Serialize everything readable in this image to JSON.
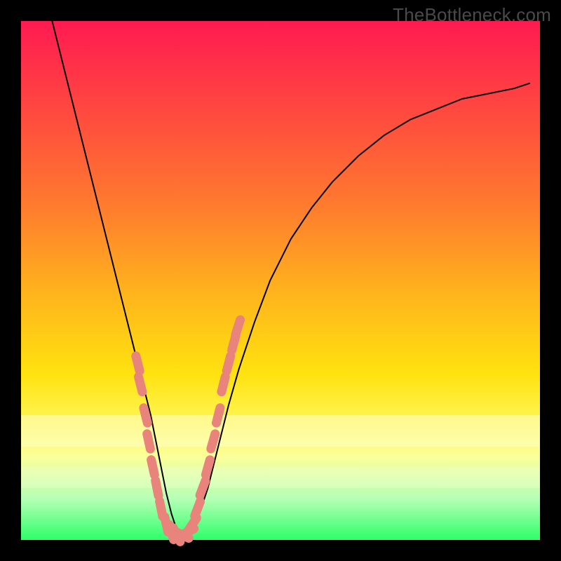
{
  "watermark": "TheBottleneck.com",
  "colors": {
    "page_bg": "#000000",
    "curve_stroke": "#000000",
    "marker_fill": "#e9847d",
    "marker_stroke": "#d96f68",
    "watermark_text": "#4a4a4a"
  },
  "chart_data": {
    "type": "line",
    "title": "",
    "xlabel": "",
    "ylabel": "",
    "xlim": [
      0,
      100
    ],
    "ylim": [
      0,
      100
    ],
    "grid": false,
    "legend": false,
    "series": [
      {
        "name": "bottleneck-curve",
        "x": [
          6,
          8,
          10,
          12,
          14,
          16,
          18,
          20,
          22,
          23,
          24,
          25,
          26,
          27,
          28,
          29,
          30,
          31,
          32,
          33,
          34,
          36,
          38,
          40,
          42,
          45,
          48,
          52,
          56,
          60,
          65,
          70,
          75,
          80,
          85,
          90,
          95,
          98
        ],
        "y": [
          100,
          92,
          84,
          76,
          68,
          60,
          52,
          44,
          36,
          32,
          28,
          24,
          19,
          14,
          9,
          5,
          2,
          1,
          1,
          2,
          4,
          10,
          18,
          26,
          33,
          42,
          50,
          58,
          64,
          69,
          74,
          78,
          81,
          83,
          85,
          86,
          87,
          88
        ]
      }
    ],
    "markers": [
      {
        "x": 22.5,
        "y": 34
      },
      {
        "x": 23.0,
        "y": 30
      },
      {
        "x": 24.0,
        "y": 24
      },
      {
        "x": 24.6,
        "y": 19
      },
      {
        "x": 25.4,
        "y": 14
      },
      {
        "x": 26.2,
        "y": 10
      },
      {
        "x": 27.0,
        "y": 6
      },
      {
        "x": 28.0,
        "y": 3
      },
      {
        "x": 29.0,
        "y": 1.5
      },
      {
        "x": 30.0,
        "y": 1
      },
      {
        "x": 31.0,
        "y": 1
      },
      {
        "x": 32.0,
        "y": 1.5
      },
      {
        "x": 33.0,
        "y": 3
      },
      {
        "x": 34.0,
        "y": 6
      },
      {
        "x": 35.0,
        "y": 10
      },
      {
        "x": 36.0,
        "y": 14
      },
      {
        "x": 37.0,
        "y": 19
      },
      {
        "x": 38.0,
        "y": 24
      },
      {
        "x": 39.0,
        "y": 30
      },
      {
        "x": 40.0,
        "y": 34
      },
      {
        "x": 41.0,
        "y": 38
      },
      {
        "x": 41.8,
        "y": 41
      }
    ]
  }
}
